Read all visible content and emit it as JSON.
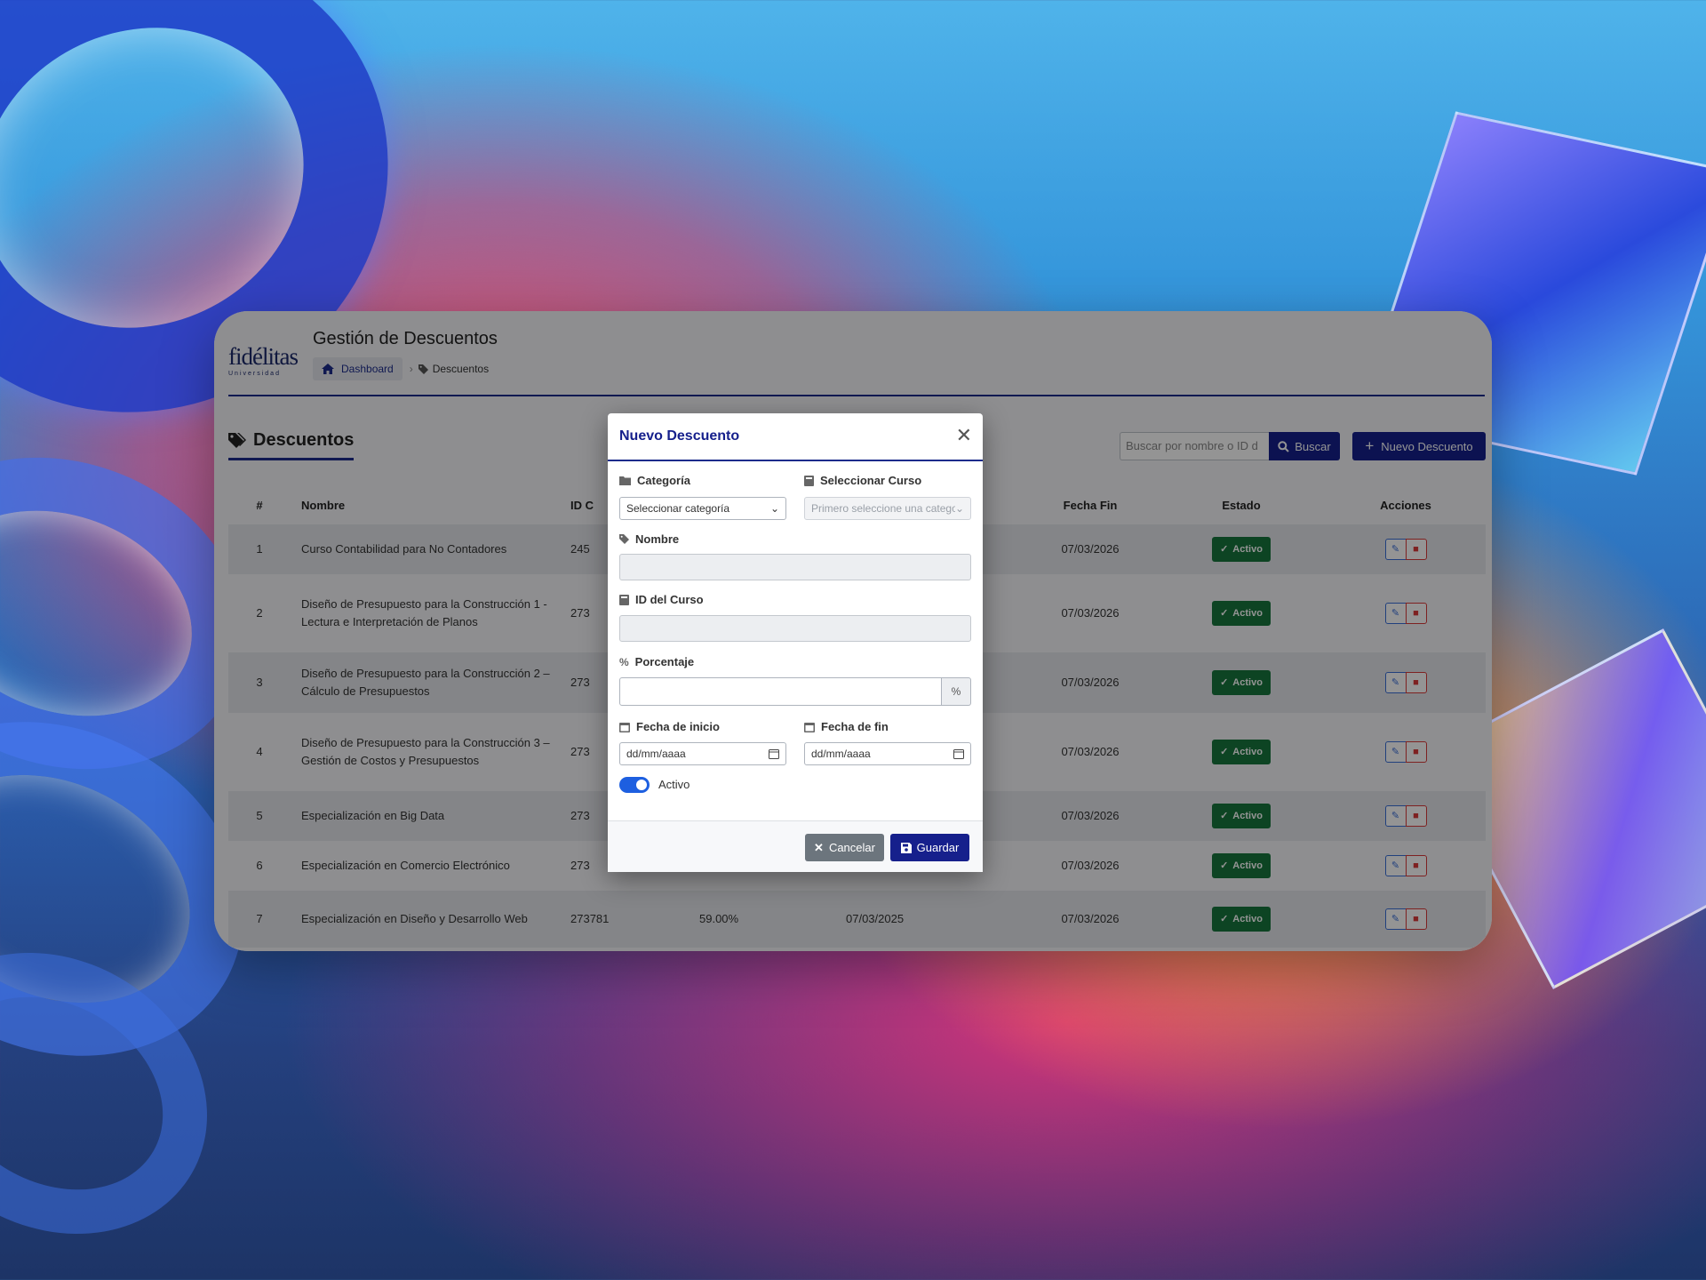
{
  "header": {
    "logo_text": "fidélitas",
    "logo_sub": "Universidad",
    "title": "Gestión de Descuentos",
    "breadcrumb_home": "Dashboard",
    "breadcrumb_current": "Descuentos"
  },
  "toolbar": {
    "section_title": "Descuentos",
    "search_placeholder": "Buscar por nombre o ID d",
    "search_label": "Buscar",
    "new_label": "Nuevo Descuento"
  },
  "table": {
    "columns": [
      "#",
      "Nombre",
      "ID C",
      "",
      "",
      "Fecha Fin",
      "Estado",
      "Acciones"
    ],
    "rows": [
      {
        "num": "1",
        "name": "Curso Contabilidad para No Contadores",
        "id": "245",
        "pct": "",
        "start": "",
        "end": "07/03/2026",
        "state": "Activo"
      },
      {
        "num": "2",
        "name": "Diseño de Presupuesto para la Construcción 1 - Lectura e Interpretación de Planos",
        "id": "273",
        "pct": "",
        "start": "",
        "end": "07/03/2026",
        "state": "Activo"
      },
      {
        "num": "3",
        "name": "Diseño de Presupuesto para la Construcción 2 – Cálculo de Presupuestos",
        "id": "273",
        "pct": "",
        "start": "",
        "end": "07/03/2026",
        "state": "Activo"
      },
      {
        "num": "4",
        "name": "Diseño de Presupuesto para la Construcción 3 – Gestión de Costos y Presupuestos",
        "id": "273",
        "pct": "",
        "start": "",
        "end": "07/03/2026",
        "state": "Activo"
      },
      {
        "num": "5",
        "name": "Especialización en Big Data",
        "id": "273",
        "pct": "",
        "start": "",
        "end": "07/03/2026",
        "state": "Activo"
      },
      {
        "num": "6",
        "name": "Especialización en Comercio Electrónico",
        "id": "273",
        "pct": "",
        "start": "",
        "end": "07/03/2026",
        "state": "Activo"
      },
      {
        "num": "7",
        "name": "Especialización en Diseño y Desarrollo Web",
        "id": "273781",
        "pct": "59.00%",
        "start": "07/03/2025",
        "end": "07/03/2026",
        "state": "Activo"
      }
    ]
  },
  "modal": {
    "title": "Nuevo Descuento",
    "close": "✕",
    "category_label": "Categoría",
    "category_value": "Seleccionar categoría",
    "course_label": "Seleccionar Curso",
    "course_value": "Primero seleccione una catego",
    "name_label": "Nombre",
    "name_value": "",
    "course_id_label": "ID del Curso",
    "course_id_value": "",
    "percent_label": "Porcentaje",
    "percent_value": "",
    "percent_addon": "%",
    "start_label": "Fecha de inicio",
    "start_value": "dd/mm/aaaa",
    "end_label": "Fecha de fin",
    "end_value": "dd/mm/aaaa",
    "active_label": "Activo",
    "active_on": true,
    "cancel_label": "Cancelar",
    "save_label": "Guardar"
  },
  "colors": {
    "primary": "#16208c",
    "success": "#18753d",
    "danger": "#d93a3a",
    "secondary": "#6c757d",
    "toggle": "#1d5fe0"
  },
  "icons": {
    "home": "home-icon",
    "tag": "tag-icon",
    "tags": "tags-icon",
    "search": "search-icon",
    "plus": "plus-icon",
    "folder": "folder-icon",
    "book": "book-icon",
    "percent": "percent-icon",
    "calendar": "calendar-icon",
    "check": "check-icon",
    "edit": "edit-icon",
    "trash": "trash-icon",
    "close": "close-icon",
    "save": "save-icon",
    "x": "x-icon"
  }
}
